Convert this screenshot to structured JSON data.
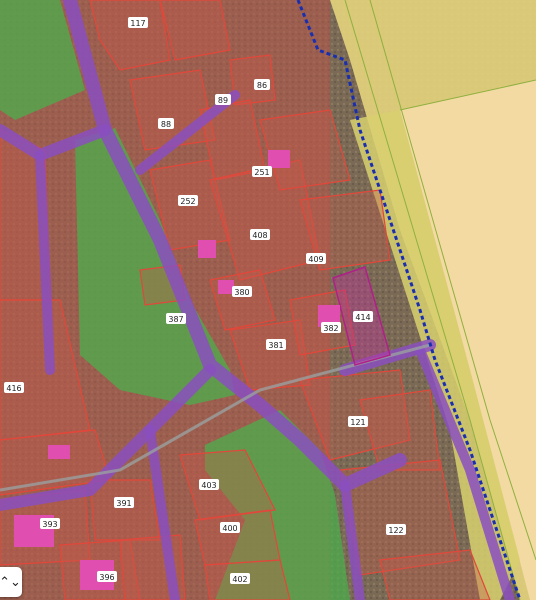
{
  "map": {
    "parcel_labels": [
      {
        "id": "p117",
        "text": "117"
      },
      {
        "id": "p86",
        "text": "86"
      },
      {
        "id": "p89",
        "text": "89"
      },
      {
        "id": "p88",
        "text": "88"
      },
      {
        "id": "p251",
        "text": "251"
      },
      {
        "id": "p252",
        "text": "252"
      },
      {
        "id": "p408",
        "text": "408"
      },
      {
        "id": "p409",
        "text": "409"
      },
      {
        "id": "p380",
        "text": "380"
      },
      {
        "id": "p387",
        "text": "387"
      },
      {
        "id": "p382",
        "text": "382"
      },
      {
        "id": "p414",
        "text": "414"
      },
      {
        "id": "p381",
        "text": "381"
      },
      {
        "id": "p416",
        "text": "416"
      },
      {
        "id": "p121",
        "text": "121"
      },
      {
        "id": "p403",
        "text": "403"
      },
      {
        "id": "p391",
        "text": "391"
      },
      {
        "id": "p393",
        "text": "393"
      },
      {
        "id": "p400",
        "text": "400"
      },
      {
        "id": "p122",
        "text": "122"
      },
      {
        "id": "p402",
        "text": "402"
      },
      {
        "id": "p396",
        "text": "396"
      }
    ],
    "colors": {
      "parcel_fill": "#c85a4a",
      "parcel_stroke": "#e2473a",
      "road_fill": "#8a4fc0",
      "green_zone": "#4cae4c",
      "yellow_zone": "#e6d27a",
      "pale_zone": "#f2d9a0",
      "boundary": "#1a2fb0",
      "selected_parcel": "#c0309a"
    },
    "zoom_control": {
      "glyph": "⌃⌄"
    }
  }
}
